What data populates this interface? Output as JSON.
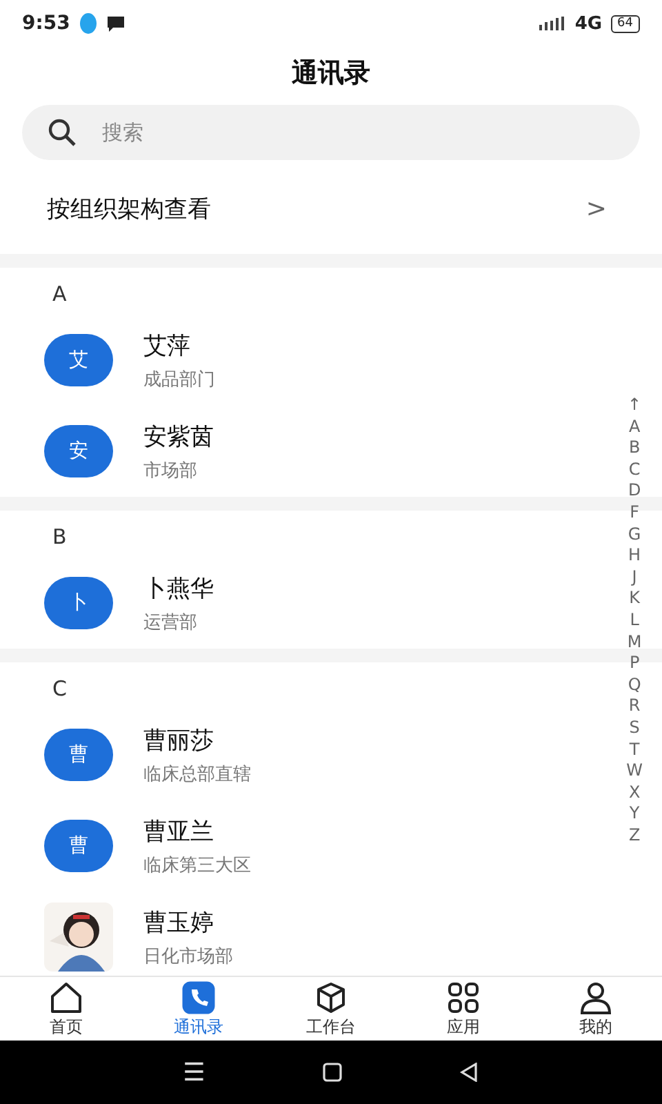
{
  "status_bar": {
    "time": "9:53",
    "network": "4G",
    "battery": "64"
  },
  "title": "通讯录",
  "search": {
    "placeholder": "搜索"
  },
  "org_link": {
    "label": "按组织架构查看",
    "chevron": ">"
  },
  "sections": [
    {
      "letter": "A",
      "contacts": [
        {
          "avatar": "艾",
          "name": "艾萍",
          "dept": "成品部门",
          "kind": "initial"
        },
        {
          "avatar": "安",
          "name": "安紫茵",
          "dept": "市场部",
          "kind": "initial"
        }
      ]
    },
    {
      "letter": "B",
      "contacts": [
        {
          "avatar": "卜",
          "name": "卜燕华",
          "dept": "运营部",
          "kind": "initial"
        }
      ]
    },
    {
      "letter": "C",
      "contacts": [
        {
          "avatar": "曹",
          "name": "曹丽莎",
          "dept": "临床总部直辖",
          "kind": "initial"
        },
        {
          "avatar": "曹",
          "name": "曹亚兰",
          "dept": "临床第三大区",
          "kind": "initial"
        },
        {
          "name": "曹玉婷",
          "dept": "日化市场部",
          "kind": "picture"
        }
      ]
    }
  ],
  "index_bar": [
    "↑",
    "A",
    "B",
    "C",
    "D",
    "F",
    "G",
    "H",
    "J",
    "K",
    "L",
    "M",
    "P",
    "Q",
    "R",
    "S",
    "T",
    "W",
    "X",
    "Y",
    "Z"
  ],
  "tabs": [
    {
      "label": "首页",
      "selected": false
    },
    {
      "label": "通讯录",
      "selected": true
    },
    {
      "label": "工作台",
      "selected": false
    },
    {
      "label": "应用",
      "selected": false
    },
    {
      "label": "我的",
      "selected": false
    }
  ],
  "system_nav": {
    "menu": "☰"
  }
}
